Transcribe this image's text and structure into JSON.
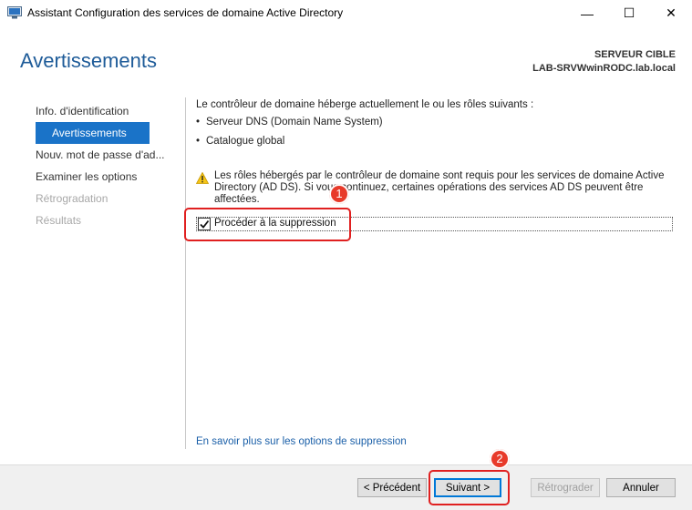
{
  "window": {
    "title": "Assistant Configuration des services de domaine Active Directory",
    "minimize": "—",
    "maximize": "☐",
    "close": "✕"
  },
  "header": {
    "page_title": "Avertissements",
    "target_label": "SERVEUR CIBLE",
    "target_server": "LAB-SRVWwinRODC.lab.local"
  },
  "nav": {
    "items": [
      {
        "label": "Info. d'identification",
        "state": "normal"
      },
      {
        "label": "Avertissements",
        "state": "active"
      },
      {
        "label": "Nouv. mot de passe d'ad...",
        "state": "normal"
      },
      {
        "label": "Examiner les options",
        "state": "normal"
      },
      {
        "label": "Rétrogradation",
        "state": "disabled"
      },
      {
        "label": "Résultats",
        "state": "disabled"
      }
    ]
  },
  "content": {
    "intro": "Le contrôleur de domaine héberge actuellement le ou les rôles suivants :",
    "roles": [
      "Serveur DNS (Domain Name System)",
      "Catalogue global"
    ],
    "warning": "Les rôles hébergés par le contrôleur de domaine sont requis pour les services de domaine Active Directory (AD DS). Si vous continuez, certaines opérations des services AD DS peuvent être affectées.",
    "checkbox_label": "Procéder à la suppression",
    "checkbox_checked": true,
    "link": "En savoir plus sur les options de suppression"
  },
  "annotations": {
    "step1": "1",
    "step2": "2",
    "color": "#e02020"
  },
  "buttons": {
    "previous": "< Précédent",
    "next": "Suivant >",
    "demote": "Rétrograder",
    "cancel": "Annuler"
  }
}
